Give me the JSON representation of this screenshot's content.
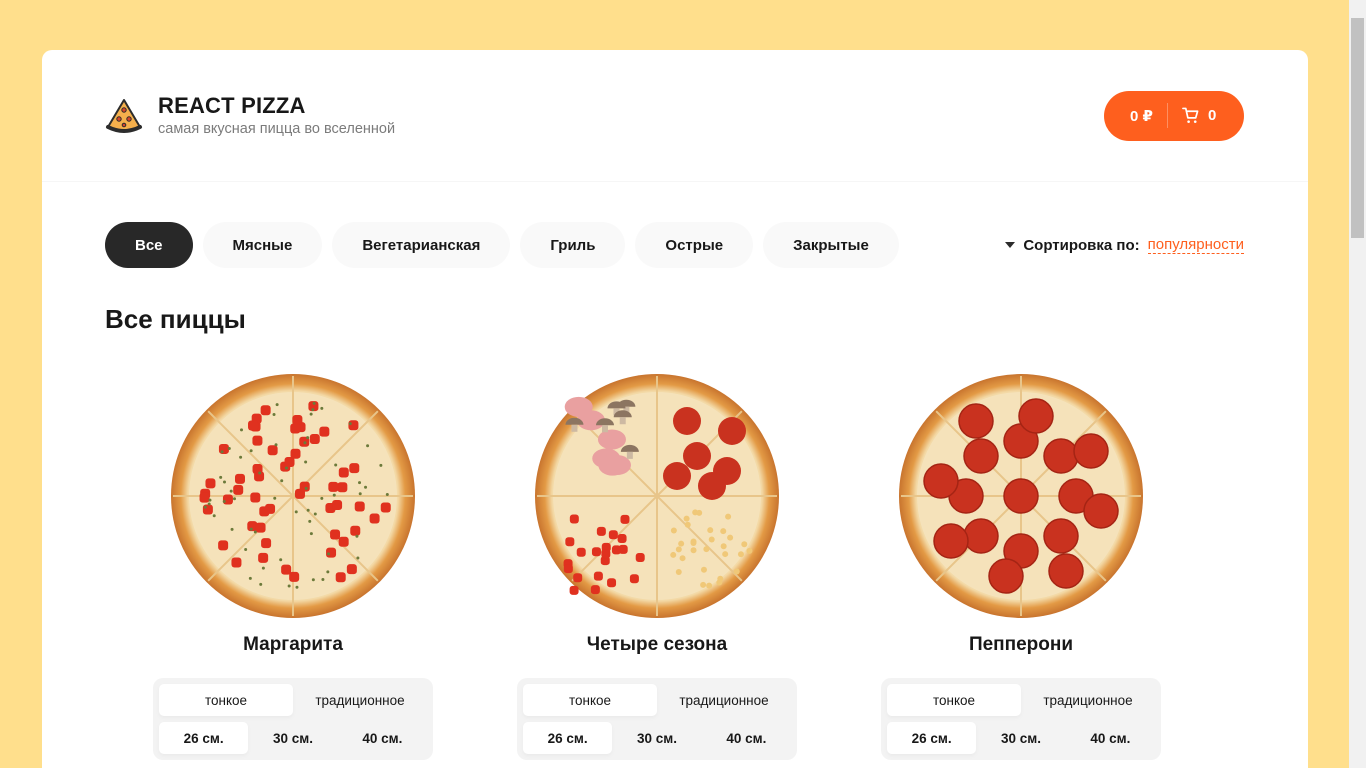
{
  "header": {
    "title": "REACT PIZZA",
    "subtitle": "самая вкусная пицца во вселенной",
    "cart_price": "0 ₽",
    "cart_count": "0"
  },
  "categories": [
    "Все",
    "Мясные",
    "Вегетарианская",
    "Гриль",
    "Острые",
    "Закрытые"
  ],
  "active_category": "Все",
  "sort": {
    "label": "Сортировка по:",
    "value": "популярности"
  },
  "section_title": "Все пиццы",
  "pizzas": [
    {
      "name": "Маргарита",
      "types": [
        "тонкое",
        "традиционное"
      ],
      "active_type": "тонкое",
      "sizes": [
        "26 см.",
        "30 см.",
        "40 см."
      ],
      "active_size": "26 см.",
      "topping": "tomato"
    },
    {
      "name": "Четыре сезона",
      "types": [
        "тонкое",
        "традиционное"
      ],
      "active_type": "тонкое",
      "sizes": [
        "26 см.",
        "30 см.",
        "40 см."
      ],
      "active_size": "26 см.",
      "topping": "mixed"
    },
    {
      "name": "Пепперони",
      "types": [
        "тонкое",
        "традиционное"
      ],
      "active_type": "тонкое",
      "sizes": [
        "26 см.",
        "30 см.",
        "40 см."
      ],
      "active_size": "26 см.",
      "topping": "pepperoni"
    }
  ],
  "colors": {
    "accent": "#FE5F1E",
    "background": "#FFDF8C",
    "dark": "#282828"
  }
}
